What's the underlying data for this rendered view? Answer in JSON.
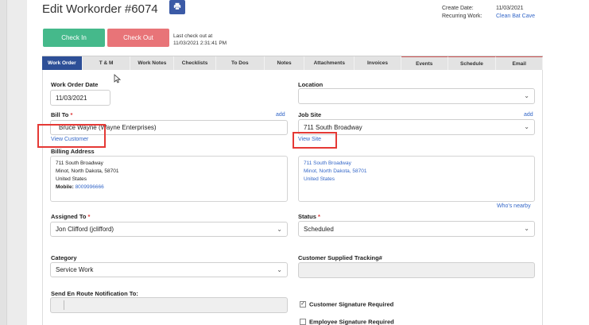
{
  "header": {
    "title": "Edit Workorder #6074",
    "create_date_label": "Create Date:",
    "create_date_value": "11/03/2021",
    "recurring_label": "Recurring Work:",
    "recurring_value": "Clean Bat Cave"
  },
  "actions": {
    "check_in": "Check In",
    "check_out": "Check Out",
    "last_checkout_line1": "Last check out at",
    "last_checkout_line2": "11/03/2021 2:31:41 PM"
  },
  "tabs": [
    "Work Order",
    "T & M",
    "Work Notes",
    "Checklists",
    "To Dos",
    "Notes",
    "Attachments",
    "Invoices",
    "Events",
    "Schedule",
    "Email"
  ],
  "form": {
    "work_order_date_label": "Work Order Date",
    "work_order_date_value": "11/03/2021",
    "location_label": "Location",
    "location_value": "",
    "bill_to_label": "Bill To",
    "bill_to_add": "add",
    "bill_to_value": "Bruce Wayne (Wayne Enterprises)",
    "view_customer": "View Customer",
    "job_site_label": "Job Site",
    "job_site_add": "add",
    "job_site_value": "711 South Broadway",
    "view_site": "View Site",
    "billing_address_label": "Billing Address",
    "billing_address": {
      "line1": "711 South Broadway",
      "line2": "Minot, North Dakota, 58701",
      "line3": "United States",
      "mobile_label": "Mobile:",
      "mobile_value": "8009996666"
    },
    "site_address": {
      "line1": "711 South Broadway",
      "line2": "Minot, North Dakota, 58701",
      "line3": "United States"
    },
    "whos_nearby": "Who's nearby",
    "assigned_to_label": "Assigned To",
    "assigned_to_value": "Jon Clifford (jclifford)",
    "status_label": "Status",
    "status_value": "Scheduled",
    "category_label": "Category",
    "category_value": "Service Work",
    "tracking_label": "Customer Supplied Tracking#",
    "tracking_value": "",
    "en_route_label": "Send En Route Notification To:",
    "customer_signature_label": "Customer Signature Required",
    "employee_signature_label": "Employee Signature Required"
  },
  "colors": {
    "brand_blue": "#2d4f97",
    "check_in_green": "#45b98b",
    "check_out_red": "#e87478",
    "link_blue": "#3467c8",
    "highlight_red": "#e53935"
  }
}
